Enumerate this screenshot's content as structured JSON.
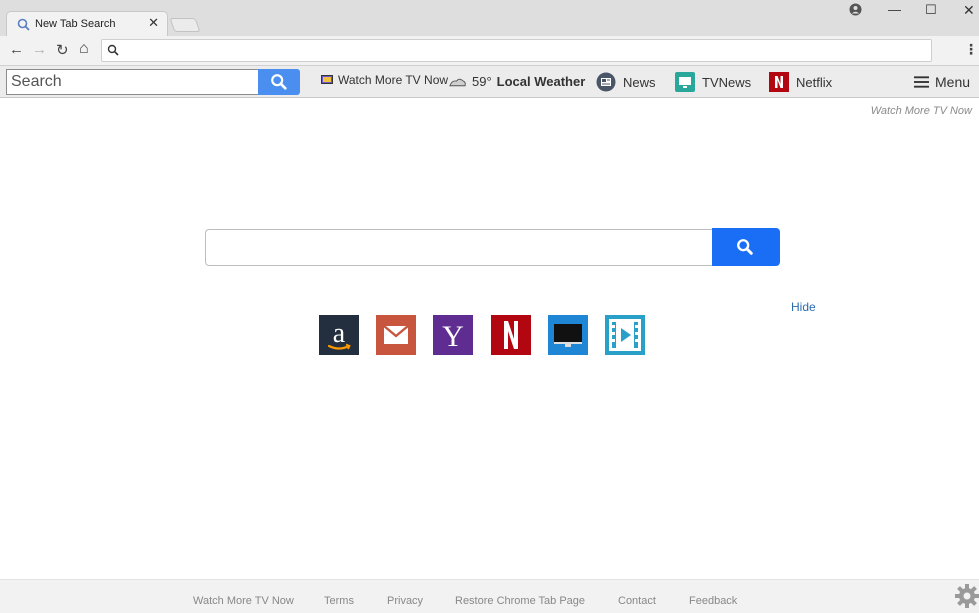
{
  "browser": {
    "tab_title": "New Tab Search",
    "tab_close": "✕",
    "window_controls": {
      "minimize": "—",
      "maximize": "☐",
      "close": "✕"
    },
    "nav": {
      "back": "←",
      "forward": "→",
      "reload": "↻",
      "home": "⌂"
    },
    "omnibox_value": "",
    "menu_dots": "⋮"
  },
  "extension_bar": {
    "search_placeholder": "Search",
    "watch_tv_label": "Watch More TV Now",
    "weather_temp": "59°",
    "weather_label": "Local Weather",
    "news_label": "News",
    "tvnews_label": "TVNews",
    "netflix_label": "Netflix",
    "menu_label": "Menu"
  },
  "page": {
    "brand": "Watch More TV Now",
    "main_search_value": "",
    "hide_label": "Hide",
    "tiles": [
      {
        "name": "amazon",
        "color": "#232f3e"
      },
      {
        "name": "gmail",
        "color": "#c8553d"
      },
      {
        "name": "yahoo",
        "color": "#5f2d91"
      },
      {
        "name": "netflix",
        "color": "#b20710"
      },
      {
        "name": "tv",
        "color": "#1f86d6"
      },
      {
        "name": "video",
        "color": "#29a0c8"
      }
    ]
  },
  "footer": {
    "links": [
      "Watch More TV Now",
      "Terms",
      "Privacy",
      "Restore Chrome Tab Page",
      "Contact",
      "Feedback"
    ]
  },
  "colors": {
    "search_button": "#1a6ef5",
    "ext_search_button": "#4a8ff0",
    "link": "#2b6cb0"
  }
}
